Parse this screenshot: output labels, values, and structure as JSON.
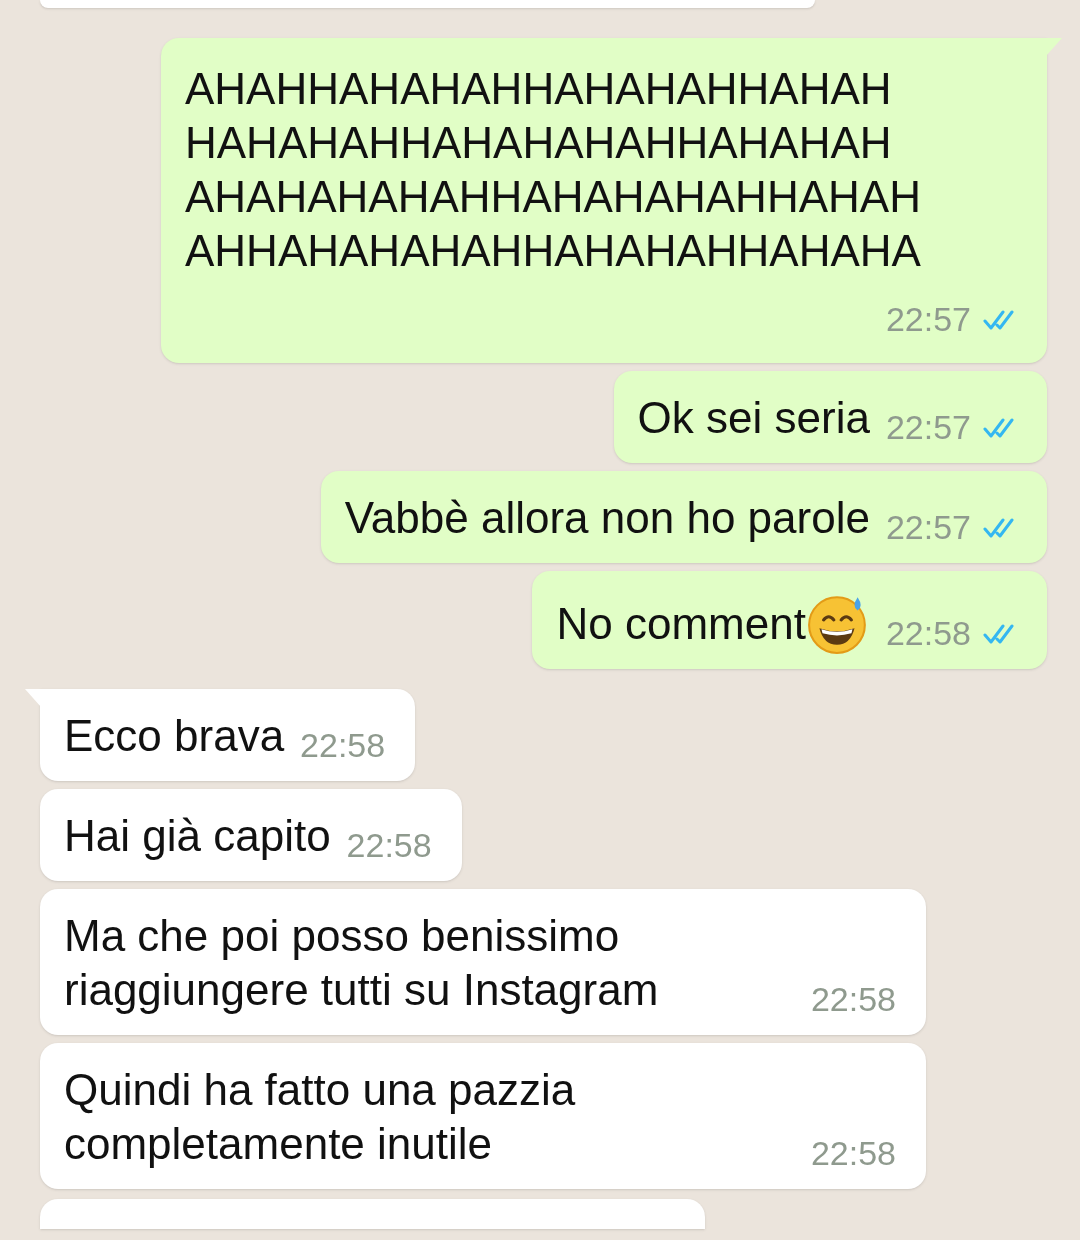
{
  "messages": [
    {
      "kind": "incoming_cut_top"
    },
    {
      "kind": "outgoing",
      "tail": true,
      "text": "AHAHHAHAHAHHAHAHAHHAHAH\nHAHAHAHHAHAHAHAHHAHAHAH\nAHAHAHAHAHHAHAHAHAHHAHAH\nAHHAHAHAHAHHAHAHAHHAHAHA",
      "time": "22:57",
      "read": true,
      "meta_below": true
    },
    {
      "kind": "outgoing",
      "tail": false,
      "text": "Ok sei seria",
      "time": "22:57",
      "read": true
    },
    {
      "kind": "outgoing",
      "tail": false,
      "text": "Vabbè allora non ho parole",
      "time": "22:57",
      "read": true
    },
    {
      "kind": "outgoing",
      "tail": false,
      "text": "No comment",
      "emoji": true,
      "time": "22:58",
      "read": true
    },
    {
      "kind": "incoming",
      "tail": true,
      "text": "Ecco brava",
      "time": "22:58"
    },
    {
      "kind": "incoming",
      "tail": false,
      "text": "Hai già capito",
      "time": "22:58"
    },
    {
      "kind": "incoming",
      "tail": false,
      "text": "Ma che poi posso benissimo\nriaggiungere tutti su Instagram",
      "time": "22:58",
      "wide": true
    },
    {
      "kind": "incoming",
      "tail": false,
      "text": "Quindi ha fatto una pazzia\ncompletamente inutile",
      "time": "22:58",
      "wide": true
    },
    {
      "kind": "incoming_cut_bottom"
    }
  ]
}
